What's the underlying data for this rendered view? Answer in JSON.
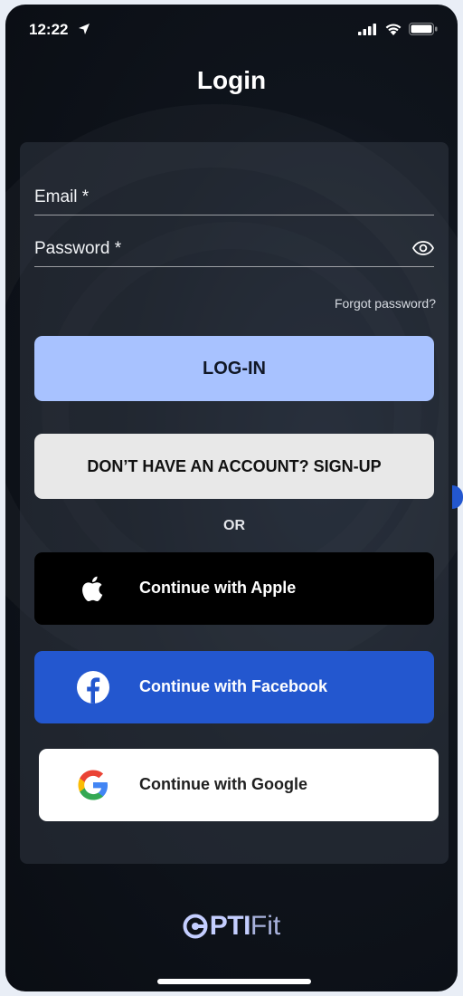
{
  "status_bar": {
    "time": "12:22",
    "icons": [
      "location-arrow-icon",
      "cellular-signal-icon",
      "wifi-icon",
      "battery-icon"
    ]
  },
  "header": {
    "title": "Login"
  },
  "form": {
    "email_label": "Email *",
    "email_value": "",
    "password_label": "Password *",
    "password_value": "",
    "password_toggle_icon": "eye-icon",
    "forgot_password": "Forgot password?"
  },
  "buttons": {
    "login": "LOG-IN",
    "signup": "DON’T HAVE AN ACCOUNT? SIGN-UP",
    "or": "OR",
    "apple": "Continue with Apple",
    "facebook": "Continue with Facebook",
    "google": "Continue with Google"
  },
  "brand": {
    "logo_bold": "PTI",
    "logo_light": "Fit"
  },
  "colors": {
    "login_button": "#a8c2ff",
    "signup_button": "#e8e8e8",
    "apple_button": "#000000",
    "facebook_button": "#2357cf",
    "google_button": "#ffffff",
    "logo": "#c4ceff"
  }
}
